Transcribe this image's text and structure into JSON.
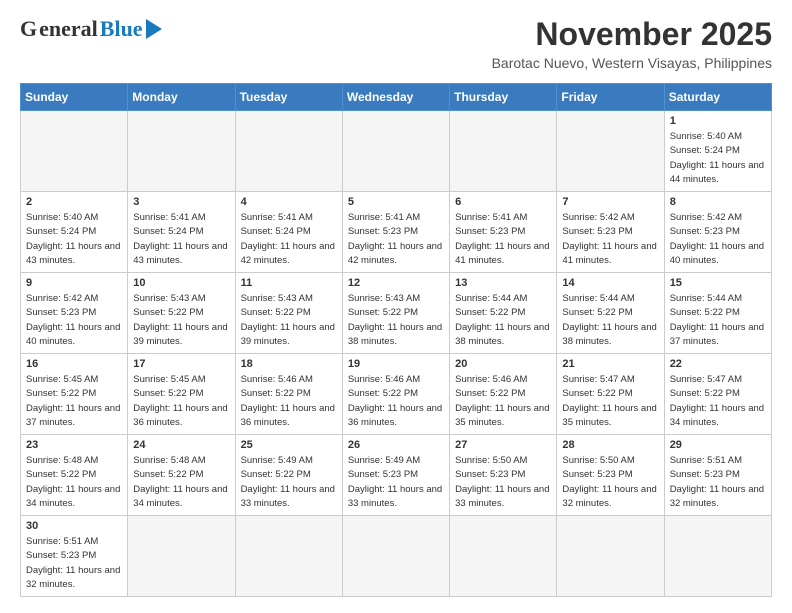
{
  "header": {
    "logo_general": "General",
    "logo_blue": "Blue",
    "month_year": "November 2025",
    "location": "Barotac Nuevo, Western Visayas, Philippines"
  },
  "days_of_week": [
    "Sunday",
    "Monday",
    "Tuesday",
    "Wednesday",
    "Thursday",
    "Friday",
    "Saturday"
  ],
  "weeks": [
    [
      {
        "day": "",
        "empty": true
      },
      {
        "day": "",
        "empty": true
      },
      {
        "day": "",
        "empty": true
      },
      {
        "day": "",
        "empty": true
      },
      {
        "day": "",
        "empty": true
      },
      {
        "day": "",
        "empty": true
      },
      {
        "day": "1",
        "sunrise": "Sunrise: 5:40 AM",
        "sunset": "Sunset: 5:24 PM",
        "daylight": "Daylight: 11 hours and 44 minutes."
      }
    ],
    [
      {
        "day": "2",
        "sunrise": "Sunrise: 5:40 AM",
        "sunset": "Sunset: 5:24 PM",
        "daylight": "Daylight: 11 hours and 43 minutes."
      },
      {
        "day": "3",
        "sunrise": "Sunrise: 5:41 AM",
        "sunset": "Sunset: 5:24 PM",
        "daylight": "Daylight: 11 hours and 43 minutes."
      },
      {
        "day": "4",
        "sunrise": "Sunrise: 5:41 AM",
        "sunset": "Sunset: 5:24 PM",
        "daylight": "Daylight: 11 hours and 42 minutes."
      },
      {
        "day": "5",
        "sunrise": "Sunrise: 5:41 AM",
        "sunset": "Sunset: 5:23 PM",
        "daylight": "Daylight: 11 hours and 42 minutes."
      },
      {
        "day": "6",
        "sunrise": "Sunrise: 5:41 AM",
        "sunset": "Sunset: 5:23 PM",
        "daylight": "Daylight: 11 hours and 41 minutes."
      },
      {
        "day": "7",
        "sunrise": "Sunrise: 5:42 AM",
        "sunset": "Sunset: 5:23 PM",
        "daylight": "Daylight: 11 hours and 41 minutes."
      },
      {
        "day": "8",
        "sunrise": "Sunrise: 5:42 AM",
        "sunset": "Sunset: 5:23 PM",
        "daylight": "Daylight: 11 hours and 40 minutes."
      }
    ],
    [
      {
        "day": "9",
        "sunrise": "Sunrise: 5:42 AM",
        "sunset": "Sunset: 5:23 PM",
        "daylight": "Daylight: 11 hours and 40 minutes."
      },
      {
        "day": "10",
        "sunrise": "Sunrise: 5:43 AM",
        "sunset": "Sunset: 5:22 PM",
        "daylight": "Daylight: 11 hours and 39 minutes."
      },
      {
        "day": "11",
        "sunrise": "Sunrise: 5:43 AM",
        "sunset": "Sunset: 5:22 PM",
        "daylight": "Daylight: 11 hours and 39 minutes."
      },
      {
        "day": "12",
        "sunrise": "Sunrise: 5:43 AM",
        "sunset": "Sunset: 5:22 PM",
        "daylight": "Daylight: 11 hours and 38 minutes."
      },
      {
        "day": "13",
        "sunrise": "Sunrise: 5:44 AM",
        "sunset": "Sunset: 5:22 PM",
        "daylight": "Daylight: 11 hours and 38 minutes."
      },
      {
        "day": "14",
        "sunrise": "Sunrise: 5:44 AM",
        "sunset": "Sunset: 5:22 PM",
        "daylight": "Daylight: 11 hours and 38 minutes."
      },
      {
        "day": "15",
        "sunrise": "Sunrise: 5:44 AM",
        "sunset": "Sunset: 5:22 PM",
        "daylight": "Daylight: 11 hours and 37 minutes."
      }
    ],
    [
      {
        "day": "16",
        "sunrise": "Sunrise: 5:45 AM",
        "sunset": "Sunset: 5:22 PM",
        "daylight": "Daylight: 11 hours and 37 minutes."
      },
      {
        "day": "17",
        "sunrise": "Sunrise: 5:45 AM",
        "sunset": "Sunset: 5:22 PM",
        "daylight": "Daylight: 11 hours and 36 minutes."
      },
      {
        "day": "18",
        "sunrise": "Sunrise: 5:46 AM",
        "sunset": "Sunset: 5:22 PM",
        "daylight": "Daylight: 11 hours and 36 minutes."
      },
      {
        "day": "19",
        "sunrise": "Sunrise: 5:46 AM",
        "sunset": "Sunset: 5:22 PM",
        "daylight": "Daylight: 11 hours and 36 minutes."
      },
      {
        "day": "20",
        "sunrise": "Sunrise: 5:46 AM",
        "sunset": "Sunset: 5:22 PM",
        "daylight": "Daylight: 11 hours and 35 minutes."
      },
      {
        "day": "21",
        "sunrise": "Sunrise: 5:47 AM",
        "sunset": "Sunset: 5:22 PM",
        "daylight": "Daylight: 11 hours and 35 minutes."
      },
      {
        "day": "22",
        "sunrise": "Sunrise: 5:47 AM",
        "sunset": "Sunset: 5:22 PM",
        "daylight": "Daylight: 11 hours and 34 minutes."
      }
    ],
    [
      {
        "day": "23",
        "sunrise": "Sunrise: 5:48 AM",
        "sunset": "Sunset: 5:22 PM",
        "daylight": "Daylight: 11 hours and 34 minutes."
      },
      {
        "day": "24",
        "sunrise": "Sunrise: 5:48 AM",
        "sunset": "Sunset: 5:22 PM",
        "daylight": "Daylight: 11 hours and 34 minutes."
      },
      {
        "day": "25",
        "sunrise": "Sunrise: 5:49 AM",
        "sunset": "Sunset: 5:22 PM",
        "daylight": "Daylight: 11 hours and 33 minutes."
      },
      {
        "day": "26",
        "sunrise": "Sunrise: 5:49 AM",
        "sunset": "Sunset: 5:23 PM",
        "daylight": "Daylight: 11 hours and 33 minutes."
      },
      {
        "day": "27",
        "sunrise": "Sunrise: 5:50 AM",
        "sunset": "Sunset: 5:23 PM",
        "daylight": "Daylight: 11 hours and 33 minutes."
      },
      {
        "day": "28",
        "sunrise": "Sunrise: 5:50 AM",
        "sunset": "Sunset: 5:23 PM",
        "daylight": "Daylight: 11 hours and 32 minutes."
      },
      {
        "day": "29",
        "sunrise": "Sunrise: 5:51 AM",
        "sunset": "Sunset: 5:23 PM",
        "daylight": "Daylight: 11 hours and 32 minutes."
      }
    ],
    [
      {
        "day": "30",
        "sunrise": "Sunrise: 5:51 AM",
        "sunset": "Sunset: 5:23 PM",
        "daylight": "Daylight: 11 hours and 32 minutes."
      },
      {
        "day": "",
        "empty": true
      },
      {
        "day": "",
        "empty": true
      },
      {
        "day": "",
        "empty": true
      },
      {
        "day": "",
        "empty": true
      },
      {
        "day": "",
        "empty": true
      },
      {
        "day": "",
        "empty": true
      }
    ]
  ]
}
